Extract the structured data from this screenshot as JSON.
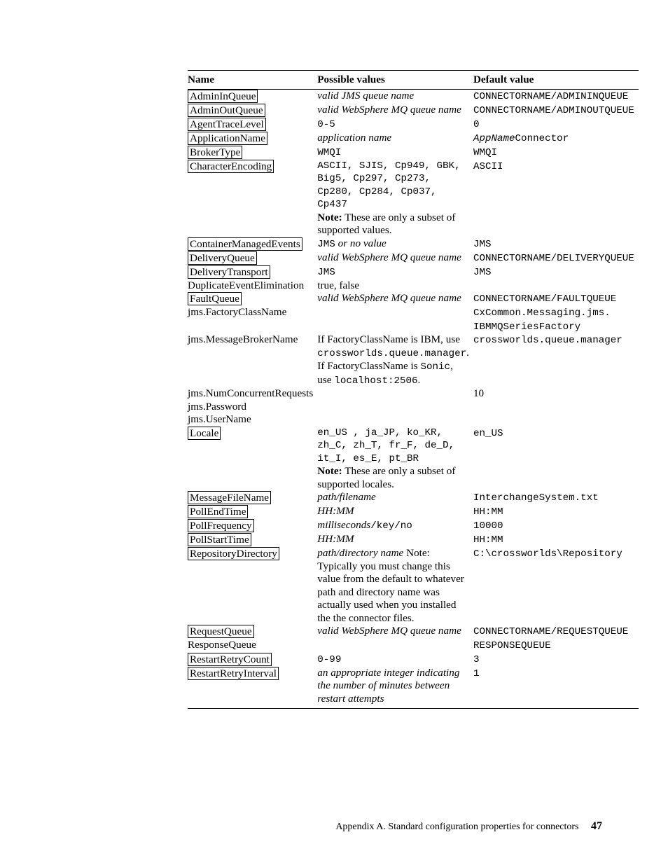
{
  "headers": {
    "name": "Name",
    "vals": "Possible values",
    "def": "Default value"
  },
  "rows": [
    {
      "name": [
        {
          "t": "AdminInQueue",
          "link": true
        }
      ],
      "vals": [
        {
          "t": "valid JMS queue name",
          "i": true
        }
      ],
      "def": [
        {
          "t": "CONNECTORNAME/ADMININQUEUE",
          "m": true
        }
      ]
    },
    {
      "name": [
        {
          "t": "AdminOutQueue",
          "link": true
        }
      ],
      "vals": [
        {
          "t": "valid WebSphere MQ queue name",
          "i": true
        }
      ],
      "def": [
        {
          "t": "CONNECTORNAME/ADMINOUTQUEUE",
          "m": true
        }
      ]
    },
    {
      "name": [
        {
          "t": "AgentTraceLevel",
          "link": true
        }
      ],
      "vals": [
        {
          "t": "0-5",
          "m": true
        }
      ],
      "def": [
        {
          "t": "0",
          "m": true
        }
      ]
    },
    {
      "name": [
        {
          "t": "ApplicationName",
          "link": true
        }
      ],
      "vals": [
        {
          "t": "application name",
          "i": true
        }
      ],
      "def": [
        {
          "t": "AppName",
          "m": true,
          "i": true
        },
        {
          "t": "Connector",
          "m": true
        }
      ]
    },
    {
      "name": [
        {
          "t": "BrokerType",
          "link": true
        }
      ],
      "vals": [
        {
          "t": "WMQI",
          "m": true
        }
      ],
      "def": [
        {
          "t": "WMQI",
          "m": true
        }
      ]
    },
    {
      "name": [
        {
          "t": "CharacterEncoding",
          "link": true
        }
      ],
      "vals": [
        {
          "t": "ASCII, SJIS, Cp949, GBK, Big5, Cp297, Cp273, Cp280, Cp284, Cp037, Cp437",
          "m": true
        },
        {
          "t": "Note:",
          "b": true
        },
        {
          "t": " These are only a subset of supported values."
        }
      ],
      "def": [
        {
          "t": "ASCII",
          "m": true
        }
      ]
    },
    {
      "name": [
        {
          "t": "ContainerManagedEvents",
          "link": true
        }
      ],
      "vals": [
        {
          "t": "JMS",
          "m": true
        },
        {
          "t": " or no value",
          "i": true
        }
      ],
      "def": [
        {
          "t": "JMS",
          "m": true
        }
      ]
    },
    {
      "name": [
        {
          "t": "DeliveryQueue",
          "link": true
        }
      ],
      "vals": [
        {
          "t": "valid WebSphere MQ queue name",
          "i": true
        }
      ],
      "def": [
        {
          "t": "CONNECTORNAME/DELIVERYQUEUE",
          "m": true
        }
      ]
    },
    {
      "name": [
        {
          "t": "DeliveryTransport",
          "link": true
        }
      ],
      "vals": [
        {
          "t": "JMS",
          "m": true
        }
      ],
      "def": [
        {
          "t": "JMS",
          "m": true
        }
      ]
    },
    {
      "name": [
        {
          "t": "DuplicateEventElimination"
        }
      ],
      "vals": [
        {
          "t": "true, false"
        }
      ],
      "def": []
    },
    {
      "name": [
        {
          "t": "FaultQueue",
          "link": true
        }
      ],
      "vals": [
        {
          "t": "valid WebSphere MQ queue name",
          "i": true
        }
      ],
      "def": [
        {
          "t": "CONNECTORNAME/FAULTQUEUE",
          "m": true
        }
      ]
    },
    {
      "name": [
        {
          "t": "jms.FactoryClassName"
        }
      ],
      "vals": [],
      "def": [
        {
          "t": "CxCommon.Messaging.jms. IBMMQSeriesFactory",
          "m": true
        }
      ]
    },
    {
      "name": [
        {
          "t": "jms.MessageBrokerName"
        }
      ],
      "vals": [
        {
          "t": "If FactoryClassName is IBM, use "
        },
        {
          "t": "crossworlds.queue.manager",
          "m": true
        },
        {
          "t": ". If FactoryClassName is "
        },
        {
          "t": "Sonic",
          "m": true
        },
        {
          "t": ", use "
        },
        {
          "t": "localhost:2506",
          "m": true
        },
        {
          "t": "."
        }
      ],
      "def": [
        {
          "t": "crossworlds.queue.manager",
          "m": true
        }
      ]
    },
    {
      "name": [
        {
          "t": "jms.NumConcurrentRequests"
        }
      ],
      "vals": [],
      "def": [
        {
          "t": "10"
        }
      ]
    },
    {
      "name": [
        {
          "t": "jms.Password"
        }
      ],
      "vals": [],
      "def": []
    },
    {
      "name": [
        {
          "t": "jms.UserName"
        }
      ],
      "vals": [],
      "def": []
    },
    {
      "name": [
        {
          "t": "Locale",
          "link": true
        }
      ],
      "vals": [
        {
          "t": "en_US , ja_JP, ko_KR, zh_C, zh_T, fr_F, de_D, it_I, es_E, pt_BR",
          "m": true
        },
        {
          "t": "Note:",
          "b": true
        },
        {
          "t": " These are only a subset of supported locales."
        }
      ],
      "def": [
        {
          "t": "en_US",
          "m": true
        }
      ]
    },
    {
      "name": [
        {
          "t": "MessageFileName",
          "link": true
        }
      ],
      "vals": [
        {
          "t": "path/filename",
          "i": true
        }
      ],
      "def": [
        {
          "t": "InterchangeSystem.txt",
          "m": true
        }
      ]
    },
    {
      "name": [
        {
          "t": "PollEndTime",
          "link": true
        }
      ],
      "vals": [
        {
          "t": "HH:MM",
          "i": true
        }
      ],
      "def": [
        {
          "t": "HH:MM",
          "m": true
        }
      ]
    },
    {
      "name": [
        {
          "t": "PollFrequency",
          "link": true
        }
      ],
      "vals": [
        {
          "t": "milliseconds",
          "i": true
        },
        {
          "t": "/key/no",
          "m": true
        }
      ],
      "def": [
        {
          "t": "10000",
          "m": true
        }
      ]
    },
    {
      "name": [
        {
          "t": "PollStartTime",
          "link": true
        }
      ],
      "vals": [
        {
          "t": "HH:MM",
          "i": true
        }
      ],
      "def": [
        {
          "t": "HH:MM",
          "m": true
        }
      ]
    },
    {
      "name": [
        {
          "t": "RepositoryDirectory",
          "link": true
        }
      ],
      "vals": [
        {
          "t": "path/directory name",
          "i": true
        },
        {
          "t": " Note: Typically you must change this value from the default to whatever path and directory name was actually used when you installed the the connector files."
        }
      ],
      "def": [
        {
          "t": "C:\\crossworlds\\Repository",
          "m": true
        }
      ]
    },
    {
      "name": [
        {
          "t": "RequestQueue",
          "link": true
        }
      ],
      "vals": [
        {
          "t": "valid WebSphere MQ queue name",
          "i": true
        }
      ],
      "def": [
        {
          "t": "CONNECTORNAME/REQUESTQUEUE",
          "m": true
        }
      ]
    },
    {
      "name": [
        {
          "t": "ResponseQueue"
        }
      ],
      "vals": [],
      "def": [
        {
          "t": "RESPONSEQUEUE",
          "m": true
        }
      ]
    },
    {
      "name": [
        {
          "t": "RestartRetryCount",
          "link": true
        }
      ],
      "vals": [
        {
          "t": "0-99",
          "m": true
        }
      ],
      "def": [
        {
          "t": "3",
          "m": true
        }
      ]
    },
    {
      "name": [
        {
          "t": "RestartRetryInterval",
          "link": true
        }
      ],
      "vals": [
        {
          "t": "an appropriate integer indicating the number of minutes between restart attempts",
          "i": true
        }
      ],
      "def": [
        {
          "t": "1",
          "m": true
        }
      ]
    }
  ],
  "footer": {
    "text": "Appendix A. Standard configuration properties for connectors",
    "page": "47"
  }
}
